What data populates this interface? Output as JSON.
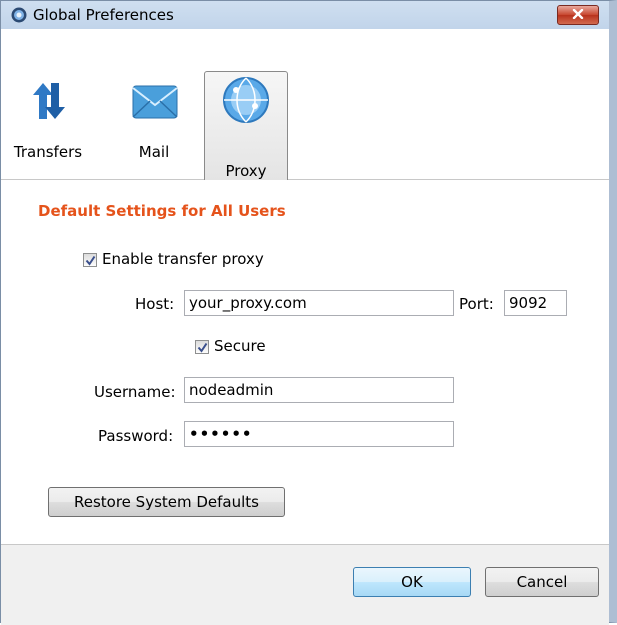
{
  "window": {
    "title": "Global Preferences",
    "app_icon": "globe-icon",
    "close_icon": "close-icon"
  },
  "toolbar": {
    "items": [
      {
        "label": "Transfers",
        "icon": "transfer-arrows-icon",
        "selected": false
      },
      {
        "label": "Mail",
        "icon": "envelope-icon",
        "selected": false
      },
      {
        "label": "Proxy",
        "icon": "globe-network-icon",
        "selected": true
      }
    ]
  },
  "settings": {
    "section_title": "Default Settings for All Users",
    "enable_proxy": {
      "label": "Enable transfer proxy",
      "checked": true
    },
    "host": {
      "label": "Host:",
      "value": "your_proxy.com"
    },
    "port": {
      "label": "Port:",
      "value": "9092"
    },
    "secure": {
      "label": "Secure",
      "checked": true
    },
    "username": {
      "label": "Username:",
      "value": "nodeadmin"
    },
    "password": {
      "label": "Password:",
      "value": "••••••"
    },
    "restore_label": "Restore System Defaults"
  },
  "footer": {
    "ok_label": "OK",
    "cancel_label": "Cancel"
  },
  "colors": {
    "section_title": "#e5531b",
    "close_button": "#c7452e",
    "ok_border": "#3c7fb1"
  }
}
